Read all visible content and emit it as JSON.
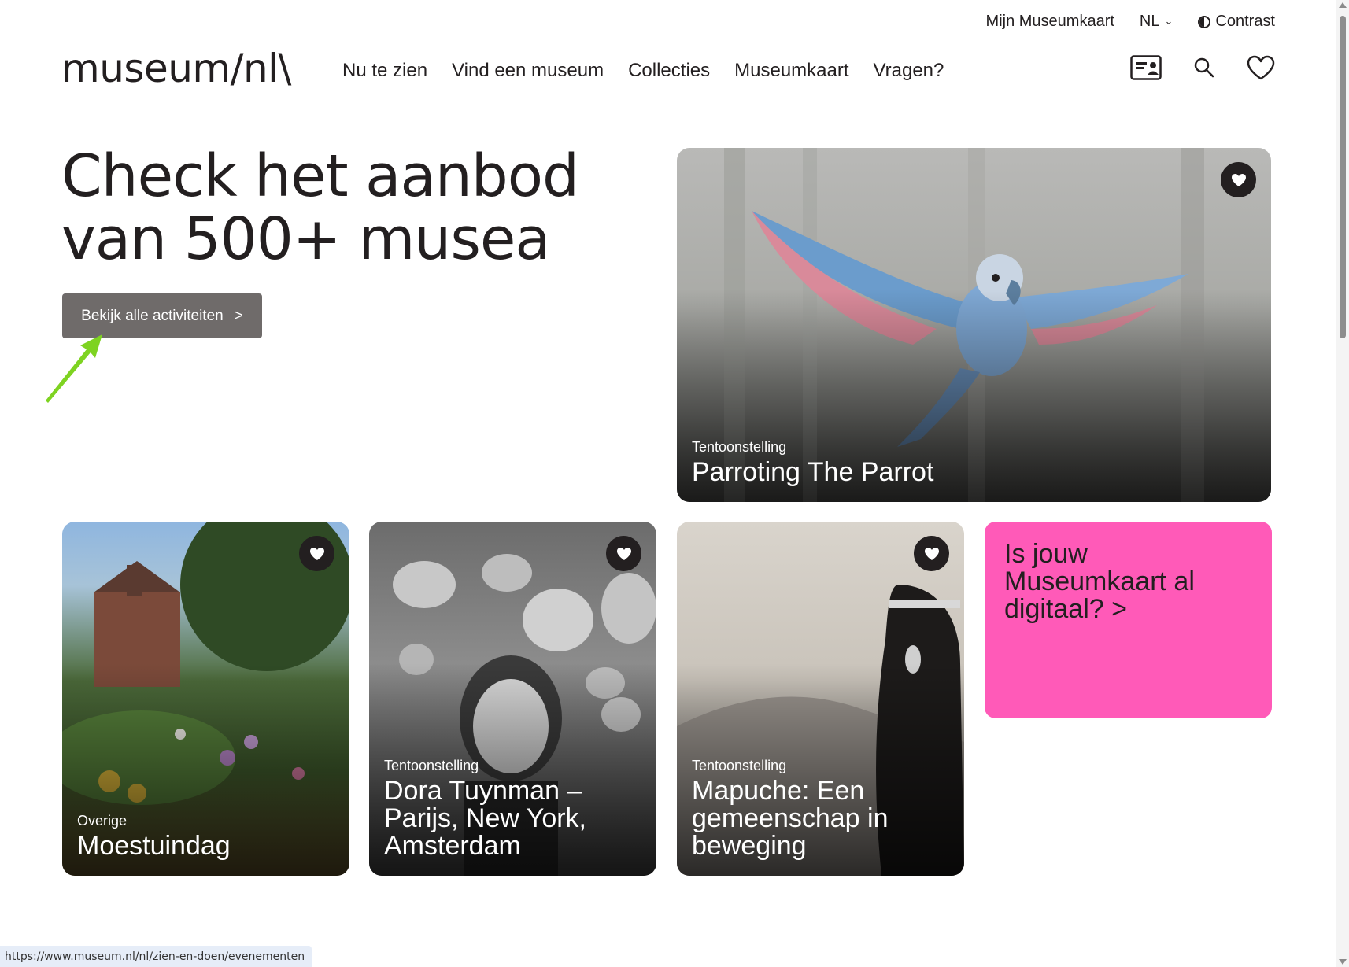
{
  "utility_nav": {
    "my_card": "Mijn Museumkaart",
    "language": "NL",
    "contrast": "Contrast"
  },
  "header": {
    "logo": "museum/nl\\",
    "nav": [
      "Nu te zien",
      "Vind een museum",
      "Collecties",
      "Museumkaart",
      "Vragen?"
    ],
    "icons": [
      "museumkaart-card-icon",
      "search-icon",
      "heart-icon"
    ]
  },
  "hero": {
    "title_line1": "Check het aanbod",
    "title_line2": "van 500+ musea",
    "cta_label": "Bekijk alle activiteiten",
    "cta_chevron": ">"
  },
  "cards": [
    {
      "type": "Tentoonstelling",
      "title": "Parroting The Parrot"
    },
    {
      "type": "Overige",
      "title": "Moestuindag"
    },
    {
      "type": "Tentoonstelling",
      "title": "Dora Tuynman – Parijs, New York, Amsterdam"
    },
    {
      "type": "Tentoonstelling",
      "title": "Mapuche: Een gemeenschap in beweging"
    }
  ],
  "promo": {
    "text": "Is jouw Museumkaart al digitaal? >",
    "color": "#ff5ab8"
  },
  "status_url": "https://www.museum.nl/nl/zien-en-doen/evenementen",
  "colors": {
    "text": "#231f20",
    "cta_background": "#6f6b6a",
    "annotation_arrow": "#7ed321"
  }
}
